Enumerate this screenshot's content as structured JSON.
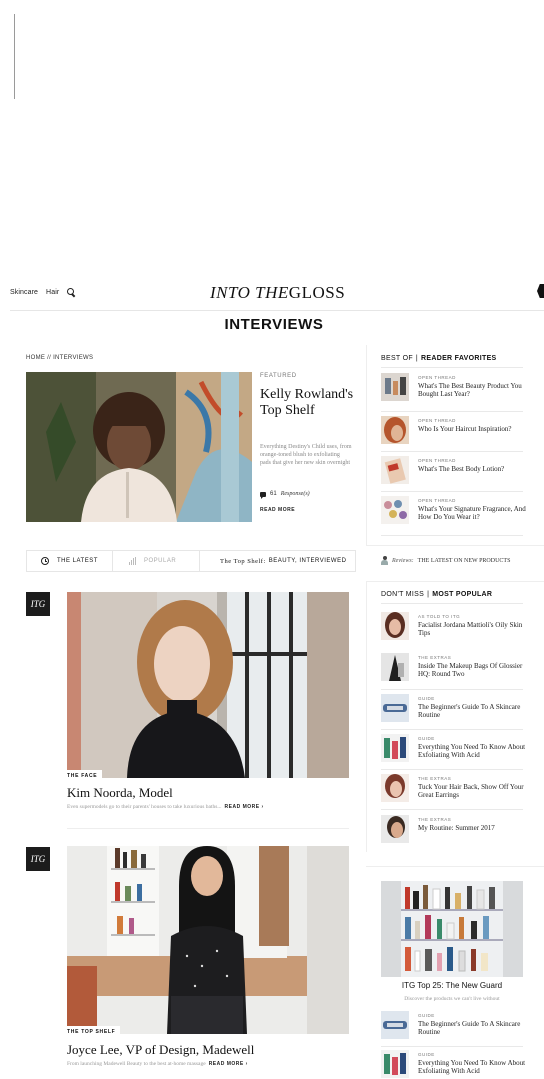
{
  "header": {
    "nav_skincare": "Skincare",
    "nav_hair": "Hair",
    "logo_italic": "INTO THE",
    "logo_rest": "GLOSS"
  },
  "page": {
    "heading": "INTERVIEWS",
    "breadcrumb": "HOME // INTERVIEWS"
  },
  "featured": {
    "label": "FEATURED",
    "title": "Kelly Rowland's Top Shelf",
    "description": "Everything Destiny's Child uses, from orange-toned blush to exfoliating pads that give her new skin overnight",
    "responses_count": "61",
    "responses_label": "Response(s)",
    "read_more": "READ MORE"
  },
  "best_of": {
    "head_left": "BEST OF",
    "head_right": "READER FAVORITES",
    "items": [
      {
        "kicker": "OPEN THREAD",
        "title": "What's The Best Beauty Product You Bought Last Year?"
      },
      {
        "kicker": "OPEN THREAD",
        "title": "Who Is Your Haircut Inspiration?"
      },
      {
        "kicker": "OPEN THREAD",
        "title": "What's The Best Body Lotion?"
      },
      {
        "kicker": "OPEN THREAD",
        "title": "What's Your Signature Fragrance, And How Do You Wear it?"
      }
    ]
  },
  "tabs": {
    "latest": "THE LATEST",
    "popular": "POPULAR",
    "topshelf_prefix": "The Top Shelf:",
    "topshelf_suffix": "BEAUTY, INTERVIEWED"
  },
  "reviews": {
    "label": "Reviews:",
    "text": "THE LATEST ON NEW PRODUCTS"
  },
  "dont_miss": {
    "head_left": "DON'T MISS",
    "head_right": "MOST POPULAR",
    "items": [
      {
        "kicker": "AS TOLD TO ITG",
        "title": "Facialist Jordana Mattioli's Oily Skin Tips"
      },
      {
        "kicker": "THE EXTRAS",
        "title": "Inside The Makeup Bags Of Glossier HQ: Round Two"
      },
      {
        "kicker": "GUIDE",
        "title": "The Beginner's Guide To A Skincare Routine"
      },
      {
        "kicker": "GUIDE",
        "title": "Everything You Need To Know About Exfoliating With Acid"
      },
      {
        "kicker": "THE EXTRAS",
        "title": "Tuck Your Hair Back, Show Off Your Great Earrings"
      },
      {
        "kicker": "THE EXTRAS",
        "title": "My Routine: Summer 2017"
      }
    ]
  },
  "articles": [
    {
      "badge": "ITG",
      "category": "THE FACE",
      "title": "Kim Noorda, Model",
      "description": "Even supermodels go to their parents' houses to take luxurious baths...",
      "read_more": "READ MORE ›"
    },
    {
      "badge": "ITG",
      "category": "THE TOP SHELF",
      "title": "Joyce Lee, VP of Design, Madewell",
      "description": "From launching Madewell Beauty to the best at-home massage",
      "read_more": "READ MORE ›"
    }
  ],
  "right_card": {
    "title": "ITG Top 25: The New Guard",
    "description": "Discover the products we can't live without",
    "items": [
      {
        "kicker": "GUIDE",
        "title": "The Beginner's Guide To A Skincare Routine"
      },
      {
        "kicker": "GUIDE",
        "title": "Everything You Need To Know About Exfoliating With Acid"
      }
    ]
  }
}
